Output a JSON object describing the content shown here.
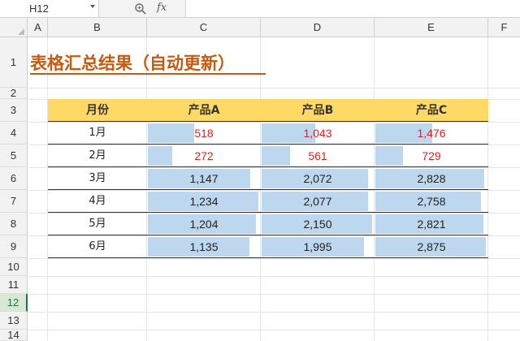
{
  "formula_bar": {
    "name_box": "H12",
    "zoom_icon": "magnifier-icon",
    "fx_label": "fx",
    "formula": ""
  },
  "columns": [
    "A",
    "B",
    "C",
    "D",
    "E",
    "F"
  ],
  "rows": [
    "1",
    "2",
    "3",
    "4",
    "5",
    "6",
    "7",
    "8",
    "9",
    "10",
    "11",
    "12",
    "13",
    "14"
  ],
  "active_row": "12",
  "title": "表格汇总结果（自动更新）",
  "table": {
    "headers": [
      "月份",
      "产品A",
      "产品B",
      "产品C"
    ],
    "rows": [
      {
        "month": "1月",
        "a": "518",
        "b": "1,043",
        "c": "1,476"
      },
      {
        "month": "2月",
        "a": "272",
        "b": "561",
        "c": "729"
      },
      {
        "month": "3月",
        "a": "1,147",
        "b": "2,072",
        "c": "2,828"
      },
      {
        "month": "4月",
        "a": "1,234",
        "b": "2,077",
        "c": "2,758"
      },
      {
        "month": "5月",
        "a": "1,204",
        "b": "2,150",
        "c": "2,821"
      },
      {
        "month": "6月",
        "a": "1,135",
        "b": "1,995",
        "c": "2,875"
      }
    ],
    "values": {
      "a": [
        518,
        272,
        1147,
        1234,
        1204,
        1135
      ],
      "b": [
        1043,
        561,
        2072,
        2077,
        2150,
        1995
      ],
      "c": [
        1476,
        729,
        2828,
        2758,
        2821,
        2875
      ]
    },
    "low_value_color": "#e02020",
    "bar_color": "#bdd7ee",
    "header_fill": "#ffd966"
  },
  "colors": {
    "title": "#c55a11",
    "active_row_accent": "#217346"
  }
}
